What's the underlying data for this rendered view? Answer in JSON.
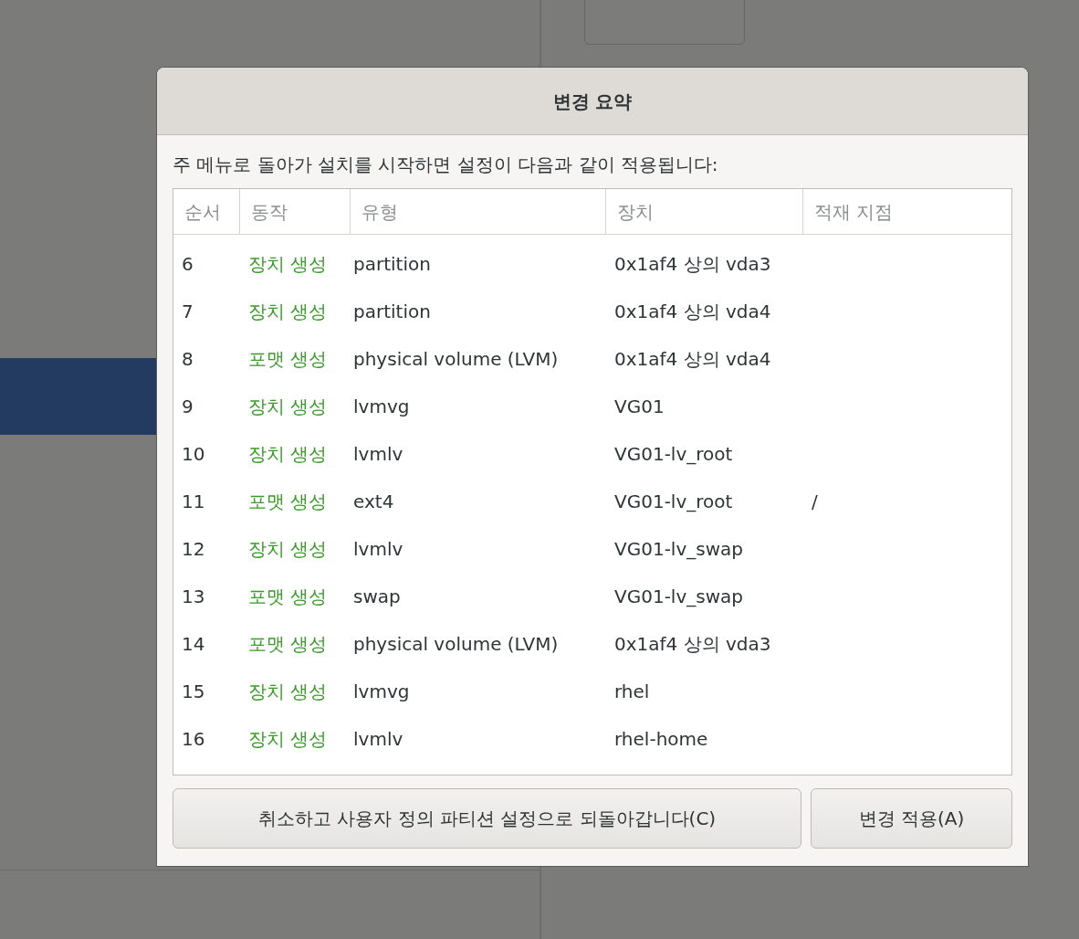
{
  "dialog": {
    "title": "변경 요약",
    "message": "주 메뉴로 돌아가 설치를 시작하면 설정이 다음과 같이 적용됩니다:",
    "table": {
      "columns": [
        "순서",
        "동작",
        "유형",
        "장치",
        "적재 지점"
      ],
      "rows": [
        {
          "order": "6",
          "action": "장치 생성",
          "type": "partition",
          "device": "0x1af4 상의 vda3"
        },
        {
          "order": "7",
          "action": "장치 생성",
          "type": "partition",
          "device": "0x1af4 상의 vda4"
        },
        {
          "order": "8",
          "action": "포맷 생성",
          "type": "physical volume (LVM)",
          "device": "0x1af4 상의 vda4"
        },
        {
          "order": "9",
          "action": "장치 생성",
          "type": "lvmvg",
          "device": "VG01"
        },
        {
          "order": "10",
          "action": "장치 생성",
          "type": "lvmlv",
          "device": "VG01-lv_root"
        },
        {
          "order": "11",
          "action": "포맷 생성",
          "type": "ext4",
          "device": "VG01-lv_root",
          "mount_point": "/"
        },
        {
          "order": "12",
          "action": "장치 생성",
          "type": "lvmlv",
          "device": "VG01-lv_swap"
        },
        {
          "order": "13",
          "action": "포맷 생성",
          "type": "swap",
          "device": "VG01-lv_swap"
        },
        {
          "order": "14",
          "action": "포맷 생성",
          "type": "physical volume (LVM)",
          "device": "0x1af4 상의 vda3"
        },
        {
          "order": "15",
          "action": "장치 생성",
          "type": "lvmvg",
          "device": "rhel"
        },
        {
          "order": "16",
          "action": "장치 생성",
          "type": "lvmlv",
          "device": "rhel-home"
        }
      ]
    },
    "buttons": [
      "취소하고 사용자 정의 파티션 설정으로 되돌아갑니다(C)",
      "변경 적용(A)"
    ]
  }
}
